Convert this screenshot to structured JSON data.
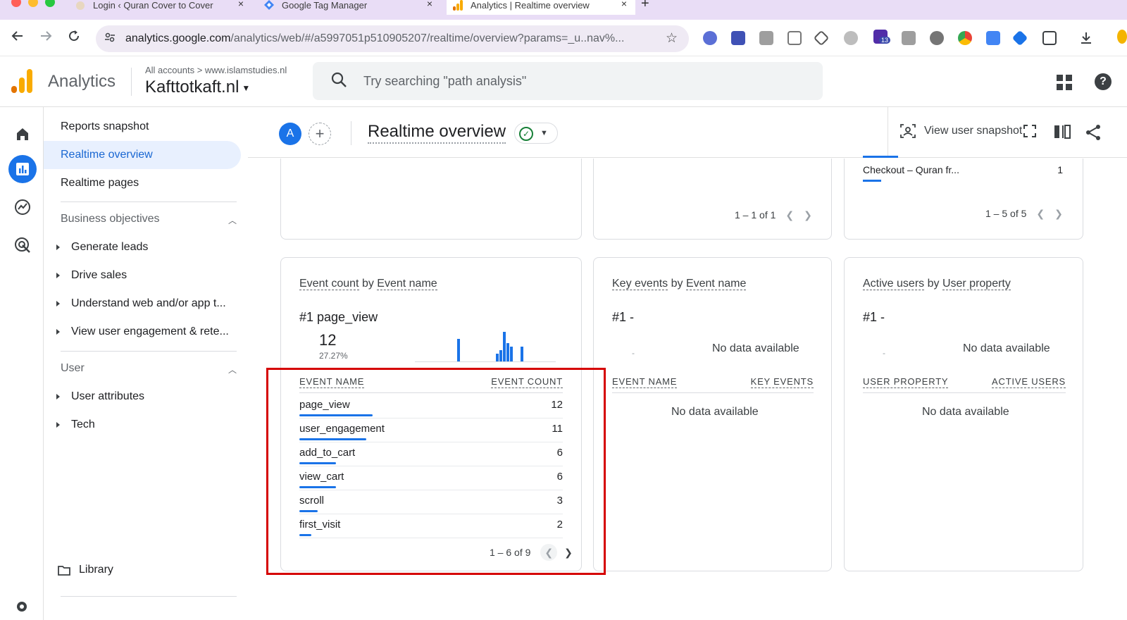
{
  "browser": {
    "tabs": [
      {
        "title": "Login ‹ Quran Cover to Cover"
      },
      {
        "title": "Google Tag Manager"
      },
      {
        "title": "Analytics | Realtime overview"
      }
    ],
    "new_tab": "+",
    "close_glyph": "×",
    "url_host": "analytics.google.com",
    "url_path": "/analytics/web/#/a5997051p510905207/realtime/overview?params=_u..nav%...",
    "extension_badge": "13"
  },
  "ga": {
    "brand": "Analytics",
    "breadcrumb": "All accounts > www.islamstudies.nl",
    "property": "Kafttotkaft.nl",
    "search_placeholder": "Try searching \"path analysis\"",
    "help_glyph": "?"
  },
  "sidenav": {
    "items": [
      {
        "label": "Reports snapshot"
      },
      {
        "label": "Realtime overview"
      },
      {
        "label": "Realtime pages"
      }
    ],
    "group_business": "Business objectives",
    "business_items": [
      {
        "label": "Generate leads"
      },
      {
        "label": "Drive sales"
      },
      {
        "label": "Understand web and/or app t..."
      },
      {
        "label": "View user engagement & rete..."
      }
    ],
    "group_user": "User",
    "user_items": [
      {
        "label": "User attributes"
      },
      {
        "label": "Tech"
      }
    ],
    "library": "Library"
  },
  "content_header": {
    "avatar": "A",
    "add": "+",
    "title": "Realtime overview",
    "view_user_snapshot": "View user snapshot"
  },
  "top_cards": {
    "middle_pager": "1 – 1 of 1",
    "right_row_name": "Checkout – Quran fr...",
    "right_row_value": "1",
    "right_pager": "1 – 5 of 5"
  },
  "event_card": {
    "title_a": "Event count",
    "title_by": " by ",
    "title_b": "Event name",
    "rank": "#1  page_view",
    "top_value": "12",
    "top_pct": "27.27%",
    "col_name": "EVENT NAME",
    "col_count": "EVENT COUNT",
    "rows": [
      {
        "name": "page_view",
        "count": "12",
        "fraction": 1.0
      },
      {
        "name": "user_engagement",
        "count": "11",
        "fraction": 0.917
      },
      {
        "name": "add_to_cart",
        "count": "6",
        "fraction": 0.5
      },
      {
        "name": "view_cart",
        "count": "6",
        "fraction": 0.5
      },
      {
        "name": "scroll",
        "count": "3",
        "fraction": 0.25
      },
      {
        "name": "first_visit",
        "count": "2",
        "fraction": 0.167
      }
    ],
    "pager": "1 – 6 of 9",
    "spark_values": [
      0,
      0,
      0,
      0,
      0,
      0,
      0,
      0,
      0,
      0,
      0,
      0,
      6,
      0,
      0,
      0,
      0,
      0,
      0,
      0,
      0,
      0,
      0,
      2,
      3,
      8,
      5,
      4,
      0,
      0,
      4,
      0,
      0,
      0,
      0,
      0,
      0,
      0,
      0,
      0
    ]
  },
  "key_events_card": {
    "title_a": "Key events",
    "title_by": " by ",
    "title_b": "Event name",
    "rank": "#1  -",
    "nodata_top": "No data available",
    "dash": "-",
    "col_name": "EVENT NAME",
    "col_value": "KEY EVENTS",
    "nodata_table": "No data available"
  },
  "active_users_card": {
    "title_a": "Active users",
    "title_by": " by ",
    "title_b": "User property",
    "rank": "#1  -",
    "nodata_top": "No data available",
    "dash": "-",
    "col_name": "USER PROPERTY",
    "col_value": "ACTIVE USERS",
    "nodata_table": "No data available"
  },
  "colors": {
    "accent": "#1a73e8",
    "highlight": "#d50000",
    "tabstrip": "#e9ddf6"
  }
}
